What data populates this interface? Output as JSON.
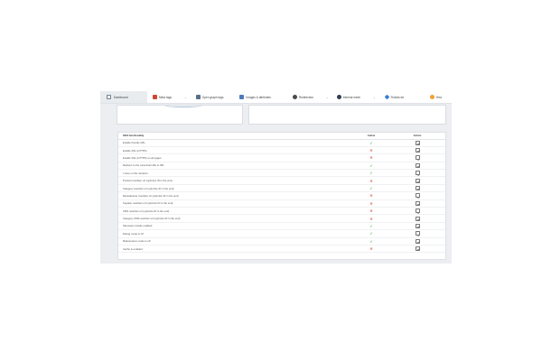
{
  "topbar": {
    "items": [
      {
        "label": "Dashboard",
        "icon": "monitor-icon",
        "color": "#7a8896"
      },
      {
        "label": "Meta tags",
        "icon": "tags-icon",
        "color": "#d0462f",
        "dropdown": true
      },
      {
        "label": "Open graph tags",
        "icon": "share-icon",
        "color": "#5a6f86"
      },
      {
        "label": "Images & attributes",
        "icon": "image-icon",
        "color": "#4f7ab8"
      },
      {
        "label": "Redirection",
        "icon": "redirect-icon",
        "color": "#4a4a4a",
        "dropdown": true
      },
      {
        "label": "Internal mesh",
        "icon": "mesh-icon",
        "color": "#2f3f52",
        "dropdown": true
      },
      {
        "label": "Robots.txt",
        "icon": "robot-icon",
        "color": "#3d7fd1"
      },
      {
        "label": "Hea",
        "icon": "sun-icon",
        "color": "#f0a030"
      }
    ]
  },
  "table": {
    "headers": [
      "SEO functionality",
      "Active",
      "Action"
    ],
    "rows": [
      {
        "label": "Enable friendly URL",
        "active": true
      },
      {
        "label": "Enable SSL (HTTPS)",
        "active": false
      },
      {
        "label": "Enable SSL (HTTPS) on all pages",
        "active": false
      },
      {
        "label": "Redirect to the canonical URL to 301",
        "active": true
      },
      {
        "label": "I store on file robotstxt",
        "active": true
      },
      {
        "label": "Product rewritten url (optimize ID in the end)",
        "active": false
      },
      {
        "label": "Category rewritten url (optimize ID in the end)",
        "active": true
      },
      {
        "label": "Manufacturer rewritten url (optimize ID in the end)",
        "active": false
      },
      {
        "label": "Supplier rewritten url (optimize ID in the end)",
        "active": false
      },
      {
        "label": "CMS rewritten url (optimize ID in the end)",
        "active": false
      },
      {
        "label": "Category CMS rewritten url (optimize ID in the end)",
        "active": false
      },
      {
        "label": "Sitemaps module enabled",
        "active": true
      },
      {
        "label": "Debug mode is off",
        "active": true
      },
      {
        "label": "Maintenance mode is off",
        "active": true
      },
      {
        "label": "Cache is enabled",
        "active": false
      }
    ]
  }
}
